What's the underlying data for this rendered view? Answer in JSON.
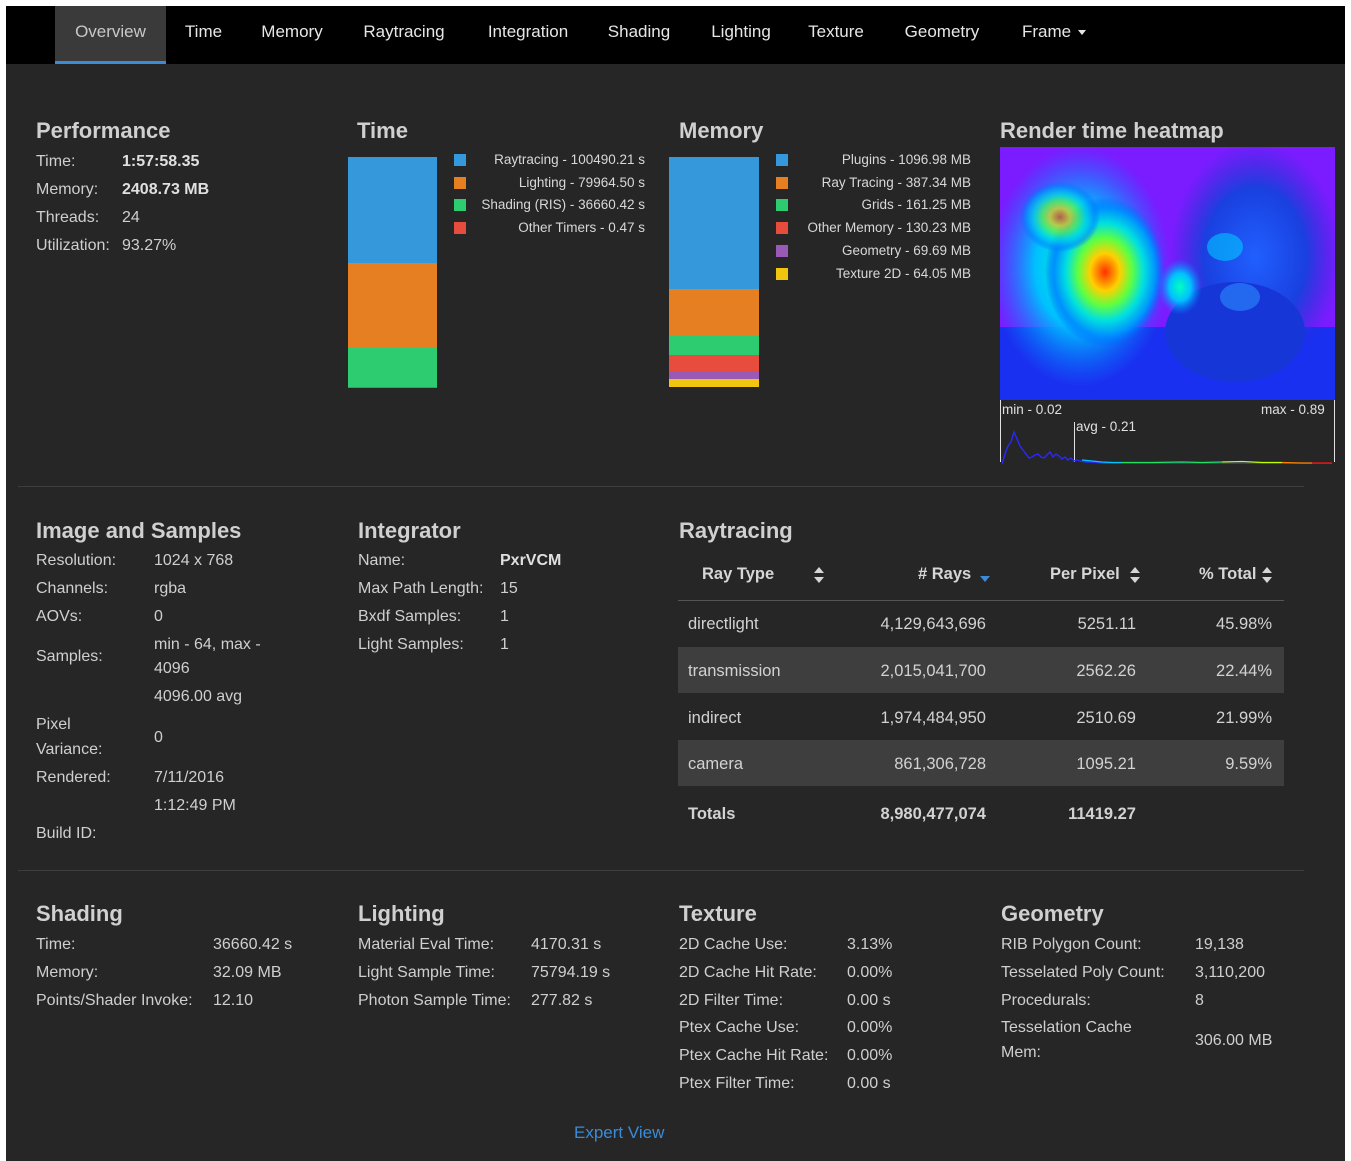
{
  "nav": {
    "tabs": [
      "Overview",
      "Time",
      "Memory",
      "Raytracing",
      "Integration",
      "Shading",
      "Lighting",
      "Texture",
      "Geometry",
      "Frame"
    ],
    "active": "Overview"
  },
  "performance": {
    "title": "Performance",
    "rows": [
      {
        "label": "Time:",
        "value": "1:57:58.35"
      },
      {
        "label": "Memory:",
        "value": "2408.73 MB"
      },
      {
        "label": "Threads:",
        "value": "24"
      },
      {
        "label": "Utilization:",
        "value": "93.27%"
      }
    ]
  },
  "time_chart": {
    "title": "Time",
    "legend": [
      {
        "label": "Raytracing - 100490.21 s",
        "color": "#3498db"
      },
      {
        "label": "Lighting - 79964.50 s",
        "color": "#e67e22"
      },
      {
        "label": "Shading (RIS) - 36660.42 s",
        "color": "#2ecc71"
      },
      {
        "label": "Other Timers - 0.47 s",
        "color": "#e74c3c"
      }
    ]
  },
  "memory_chart": {
    "title": "Memory",
    "legend": [
      {
        "label": "Plugins - 1096.98 MB",
        "color": "#3498db"
      },
      {
        "label": "Ray Tracing - 387.34 MB",
        "color": "#e67e22"
      },
      {
        "label": "Grids - 161.25 MB",
        "color": "#2ecc71"
      },
      {
        "label": "Other Memory - 130.23 MB",
        "color": "#e74c3c"
      },
      {
        "label": "Geometry - 69.69 MB",
        "color": "#9b59b6"
      },
      {
        "label": "Texture 2D - 64.05 MB",
        "color": "#f1c40f"
      }
    ]
  },
  "chart_data": [
    {
      "type": "bar",
      "title": "Time",
      "stacked": true,
      "categories": [
        "Time"
      ],
      "series": [
        {
          "name": "Raytracing",
          "values": [
            100490.21
          ]
        },
        {
          "name": "Lighting",
          "values": [
            79964.5
          ]
        },
        {
          "name": "Shading (RIS)",
          "values": [
            36660.42
          ]
        },
        {
          "name": "Other Timers",
          "values": [
            0.47
          ]
        }
      ],
      "legend": "right"
    },
    {
      "type": "bar",
      "title": "Memory",
      "stacked": true,
      "categories": [
        "Memory"
      ],
      "series": [
        {
          "name": "Plugins",
          "values": [
            1096.98
          ]
        },
        {
          "name": "Ray Tracing",
          "values": [
            387.34
          ]
        },
        {
          "name": "Grids",
          "values": [
            161.25
          ]
        },
        {
          "name": "Other Memory",
          "values": [
            130.23
          ]
        },
        {
          "name": "Geometry",
          "values": [
            69.69
          ]
        },
        {
          "name": "Texture 2D",
          "values": [
            64.05
          ]
        }
      ],
      "legend": "right"
    }
  ],
  "heatmap": {
    "title": "Render time heatmap",
    "min_label": "min - 0.02",
    "max_label": "max - 0.89",
    "avg_label": "avg - 0.21"
  },
  "image_samples": {
    "title": "Image and Samples",
    "resolution_label": "Resolution:",
    "resolution": "1024 x 768",
    "channels_label": "Channels:",
    "channels": "rgba",
    "aovs_label": "AOVs:",
    "aovs": "0",
    "samples_label": "Samples:",
    "samples_line1": "min - 64, max -",
    "samples_line2": "4096",
    "samples_avg": "4096.00 avg",
    "pixel_label1": "Pixel",
    "pixel_label2": "Variance:",
    "pixel_variance": "0",
    "rendered_label": "Rendered:",
    "rendered_date": "7/11/2016",
    "rendered_time": "1:12:49 PM",
    "build_label": "Build ID:"
  },
  "integrator": {
    "title": "Integrator",
    "rows": [
      {
        "label": "Name:",
        "value": "PxrVCM"
      },
      {
        "label": "Max Path Length:",
        "value": "15"
      },
      {
        "label": "Bxdf Samples:",
        "value": "1"
      },
      {
        "label": "Light Samples:",
        "value": "1"
      }
    ]
  },
  "raytracing": {
    "title": "Raytracing",
    "headers": [
      "Ray Type",
      "# Rays",
      "Per Pixel",
      "% Total"
    ],
    "rows": [
      [
        "directlight",
        "4,129,643,696",
        "5251.11",
        "45.98%"
      ],
      [
        "transmission",
        "2,015,041,700",
        "2562.26",
        "22.44%"
      ],
      [
        "indirect",
        "1,974,484,950",
        "2510.69",
        "21.99%"
      ],
      [
        "camera",
        "861,306,728",
        "1095.21",
        "9.59%"
      ]
    ],
    "totals": [
      "Totals",
      "8,980,477,074",
      "11419.27"
    ]
  },
  "shading": {
    "title": "Shading",
    "rows": [
      {
        "label": "Time:",
        "value": "36660.42 s"
      },
      {
        "label": "Memory:",
        "value": "32.09 MB"
      },
      {
        "label": "Points/Shader Invoke:",
        "value": "12.10"
      }
    ]
  },
  "lighting": {
    "title": "Lighting",
    "rows": [
      {
        "label": "Material Eval Time:",
        "value": "4170.31 s"
      },
      {
        "label": "Light Sample Time:",
        "value": "75794.19 s"
      },
      {
        "label": "Photon Sample Time:",
        "value": "277.82 s"
      }
    ]
  },
  "texture": {
    "title": "Texture",
    "rows": [
      {
        "label": "2D Cache Use:",
        "value": "3.13%"
      },
      {
        "label": "2D Cache Hit Rate:",
        "value": "0.00%"
      },
      {
        "label": "2D Filter Time:",
        "value": "0.00 s"
      },
      {
        "label": "Ptex Cache Use:",
        "value": "0.00%"
      },
      {
        "label": "Ptex Cache Hit Rate:",
        "value": "0.00%"
      },
      {
        "label": "Ptex Filter Time:",
        "value": "0.00 s"
      }
    ]
  },
  "geometry": {
    "title": "Geometry",
    "rows": [
      {
        "label": "RIB Polygon Count:",
        "value": "19,138"
      },
      {
        "label": "Tesselated Poly Count:",
        "value": "3,110,200"
      },
      {
        "label": "Procedurals:",
        "value": "8"
      }
    ],
    "cache_label1": "Tesselation Cache",
    "cache_label2": "Mem:",
    "cache_value": "306.00 MB"
  },
  "footer": {
    "expert_view": "Expert View"
  }
}
